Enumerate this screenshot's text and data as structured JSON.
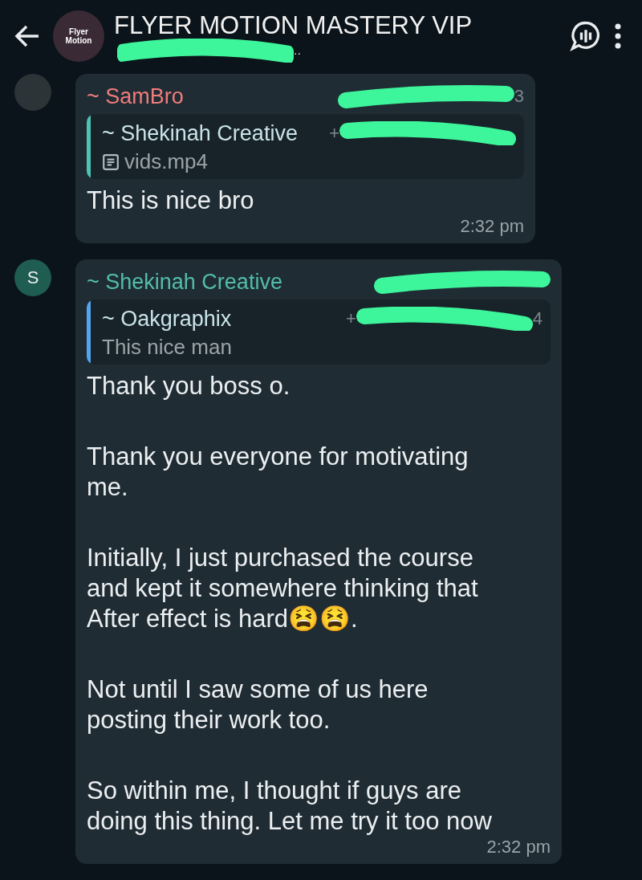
{
  "header": {
    "title": "FLYER MOTION MASTERY VIP",
    "subtitle_end": "..",
    "avatar_text": "Flyer Motion"
  },
  "messages": [
    {
      "sender": "~ SamBro",
      "color": "#f07c7c",
      "avatar": {
        "kind": "photo"
      },
      "phone": {
        "end": "3"
      },
      "quote": {
        "sender": "~ Shekinah Creative",
        "color": "#4fc3b5",
        "phone": {
          "start": "+"
        },
        "kind": "file",
        "text": "vids.mp4"
      },
      "paragraphs": [
        "This is nice bro"
      ],
      "time": "2:32 pm"
    },
    {
      "sender": "~ Shekinah Creative",
      "color": "#53bdaa",
      "avatar": {
        "kind": "letter",
        "text": "S"
      },
      "quote": {
        "sender": "~ Oakgraphix",
        "color": "#53a6f0",
        "phone": {
          "start": "+",
          "end": "4"
        },
        "kind": "text",
        "text": "This nice man"
      },
      "paragraphs": [
        "Thank you boss o.",
        "Thank you everyone for motivating me.",
        "Initially, I just purchased the course and kept it somewhere thinking that After effect is hard😫😫.",
        "Not until I saw some of us here posting their work too.",
        "So within me, I thought if guys are doing this thing. Let me try it too now"
      ],
      "time": "2:32 pm"
    }
  ]
}
